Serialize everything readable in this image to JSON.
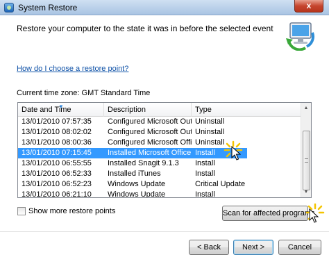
{
  "window": {
    "title": "System Restore",
    "close_label": "x"
  },
  "header": {
    "heading": "Restore your computer to the state it was in before the selected event"
  },
  "help_link": "How do I choose a restore point?",
  "timezone": "Current time zone: GMT Standard Time",
  "table": {
    "columns": [
      "Date and Time",
      "Description",
      "Type"
    ],
    "rows": [
      {
        "date": "13/01/2010 07:57:35",
        "description": "Configured Microsoft Outlo...",
        "type": "Uninstall"
      },
      {
        "date": "13/01/2010 08:02:02",
        "description": "Configured Microsoft Outlo...",
        "type": "Uninstall"
      },
      {
        "date": "13/01/2010 08:00:36",
        "description": "Configured Microsoft Offic...",
        "type": "Uninstall"
      },
      {
        "date": "13/01/2010 07:15:45",
        "description": "Installed Microsoft Office P...",
        "type": "Install"
      },
      {
        "date": "13/01/2010 06:55:55",
        "description": "Installed Snagit 9.1.3",
        "type": "Install"
      },
      {
        "date": "13/01/2010 06:52:33",
        "description": "Installed iTunes",
        "type": "Install"
      },
      {
        "date": "13/01/2010 06:52:23",
        "description": "Windows Update",
        "type": "Critical Update"
      },
      {
        "date": "13/01/2010 06:21:10",
        "description": "Windows Update",
        "type": "Install"
      }
    ],
    "selected_index": 3
  },
  "checkbox": {
    "label": "Show more restore points",
    "checked": false
  },
  "buttons": {
    "scan": "Scan for affected programs",
    "back": "< Back",
    "next": "Next >",
    "cancel": "Cancel"
  },
  "colors": {
    "selection": "#3399ff",
    "link": "#0b4fa6",
    "titlebar": "#a9c4e3"
  }
}
